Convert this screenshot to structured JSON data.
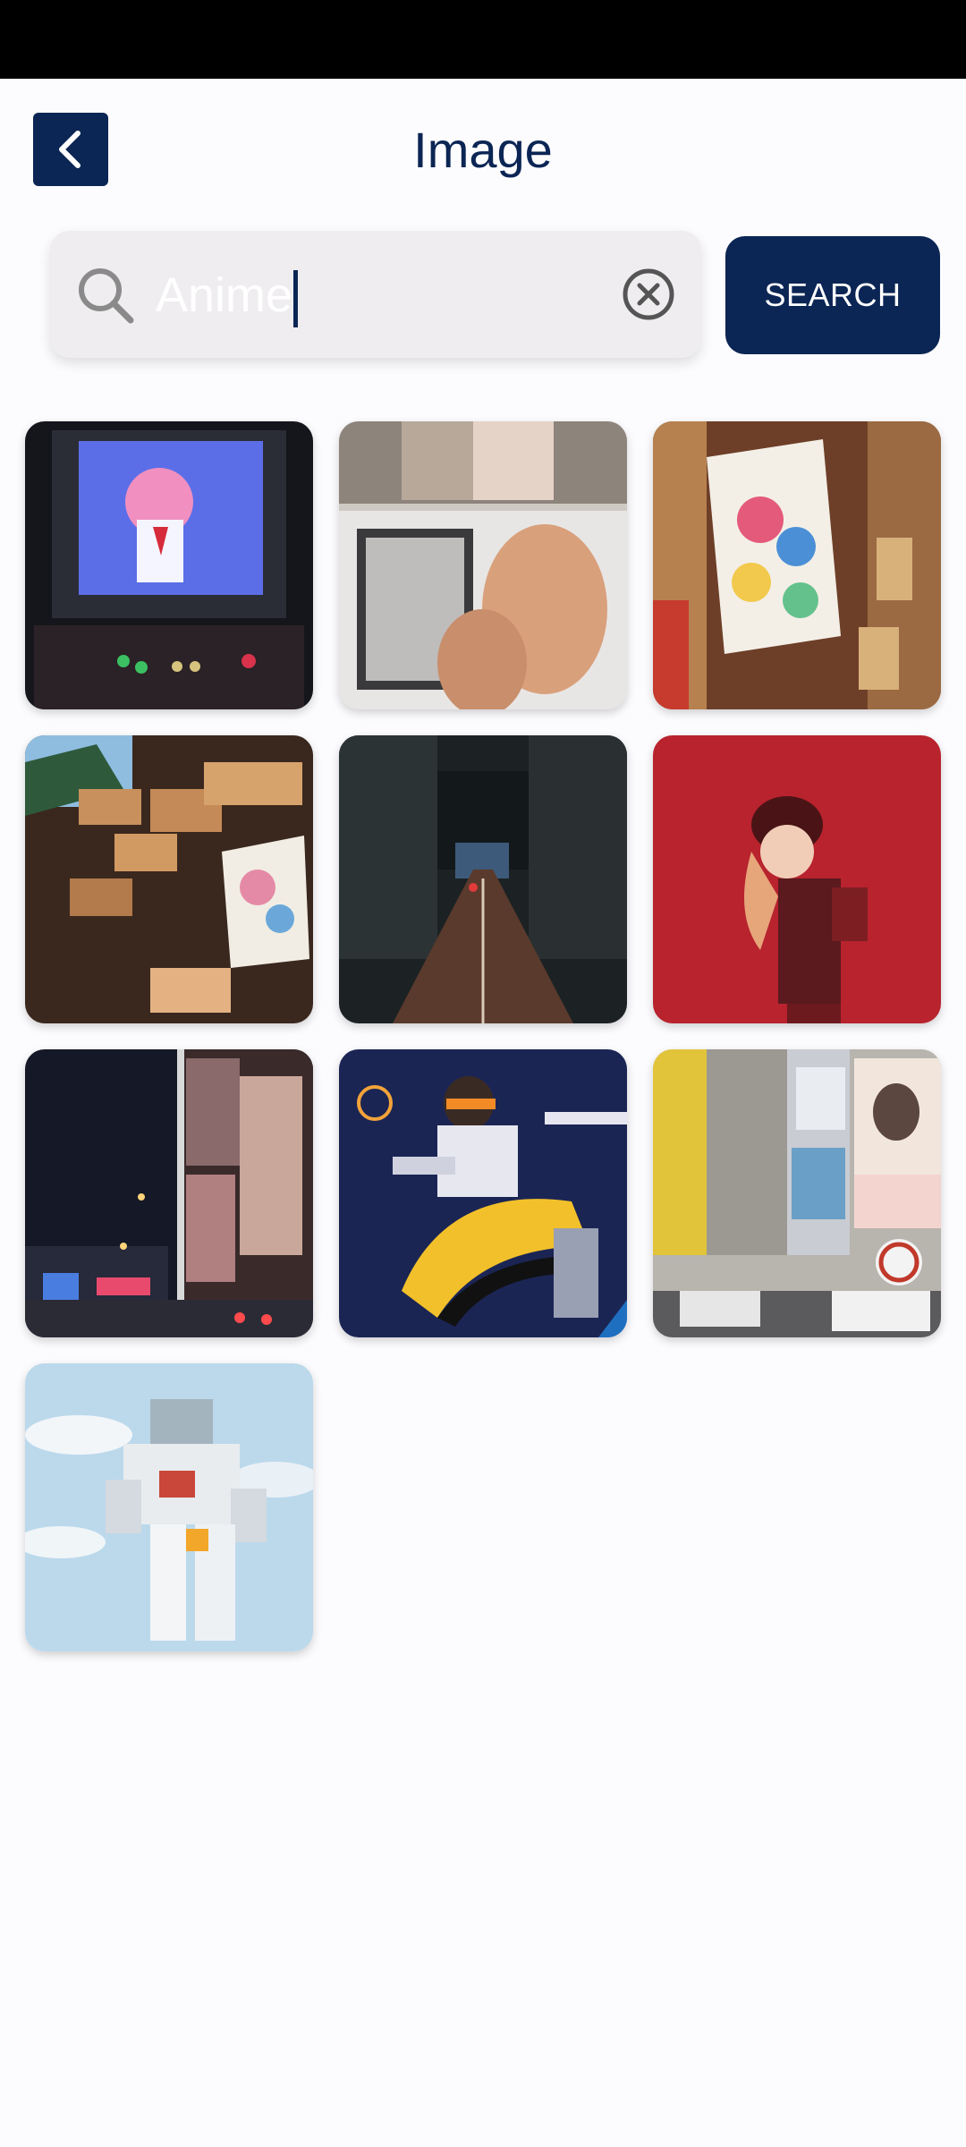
{
  "header": {
    "title": "Image"
  },
  "search": {
    "query": "Anime",
    "button_label": "SEARCH"
  },
  "colors": {
    "brand_navy": "#0b2554",
    "search_bg": "#efedf0"
  },
  "icons": {
    "back": "chevron-left-icon",
    "search": "search-icon",
    "clear": "clear-circle-x-icon"
  },
  "results": [
    {
      "subject": "arcade-cabinet-anime-girl"
    },
    {
      "subject": "hands-on-anime-panels"
    },
    {
      "subject": "shrine-ema-plaques-anime"
    },
    {
      "subject": "ema-plaque-wall"
    },
    {
      "subject": "night-street-tokyo"
    },
    {
      "subject": "cosplay-figure-red-background"
    },
    {
      "subject": "akihabara-night-billboards"
    },
    {
      "subject": "tracer-action-figure"
    },
    {
      "subject": "akihabara-day-street"
    },
    {
      "subject": "gundam-statue-sky"
    }
  ]
}
